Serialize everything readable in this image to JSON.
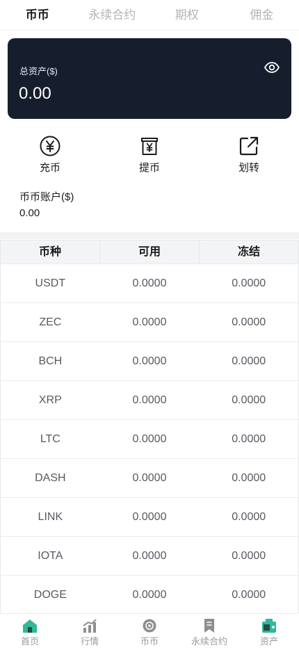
{
  "top_tabs": [
    {
      "label": "币币",
      "active": true
    },
    {
      "label": "永续合约",
      "active": false
    },
    {
      "label": "期权",
      "active": false
    },
    {
      "label": "佣金",
      "active": false
    }
  ],
  "asset_card": {
    "label": "总资产($)",
    "value": "0.00",
    "icon": "eye-icon"
  },
  "actions": [
    {
      "label": "充币",
      "icon": "yen-circle-icon"
    },
    {
      "label": "提币",
      "icon": "yen-wallet-icon"
    },
    {
      "label": "划转",
      "icon": "share-external-icon"
    }
  ],
  "spot_account": {
    "label": "币币账户($)",
    "value": "0.00"
  },
  "table": {
    "headers": [
      "币种",
      "可用",
      "冻结"
    ],
    "rows": [
      [
        "USDT",
        "0.0000",
        "0.0000"
      ],
      [
        "ZEC",
        "0.0000",
        "0.0000"
      ],
      [
        "BCH",
        "0.0000",
        "0.0000"
      ],
      [
        "XRP",
        "0.0000",
        "0.0000"
      ],
      [
        "LTC",
        "0.0000",
        "0.0000"
      ],
      [
        "DASH",
        "0.0000",
        "0.0000"
      ],
      [
        "LINK",
        "0.0000",
        "0.0000"
      ],
      [
        "IOTA",
        "0.0000",
        "0.0000"
      ],
      [
        "DOGE",
        "0.0000",
        "0.0000"
      ]
    ]
  },
  "bottom_nav": [
    {
      "label": "首页",
      "icon": "home-icon",
      "active": false
    },
    {
      "label": "行情",
      "icon": "market-chart-icon",
      "active": false
    },
    {
      "label": "币币",
      "icon": "coin-icon",
      "active": false
    },
    {
      "label": "永续合约",
      "icon": "contract-icon",
      "active": false
    },
    {
      "label": "资产",
      "icon": "assets-icon",
      "active": true
    }
  ],
  "colors": {
    "card_bg": "#161e2e",
    "accent_teal": "#2fb89a",
    "muted": "#9a9a9a"
  }
}
